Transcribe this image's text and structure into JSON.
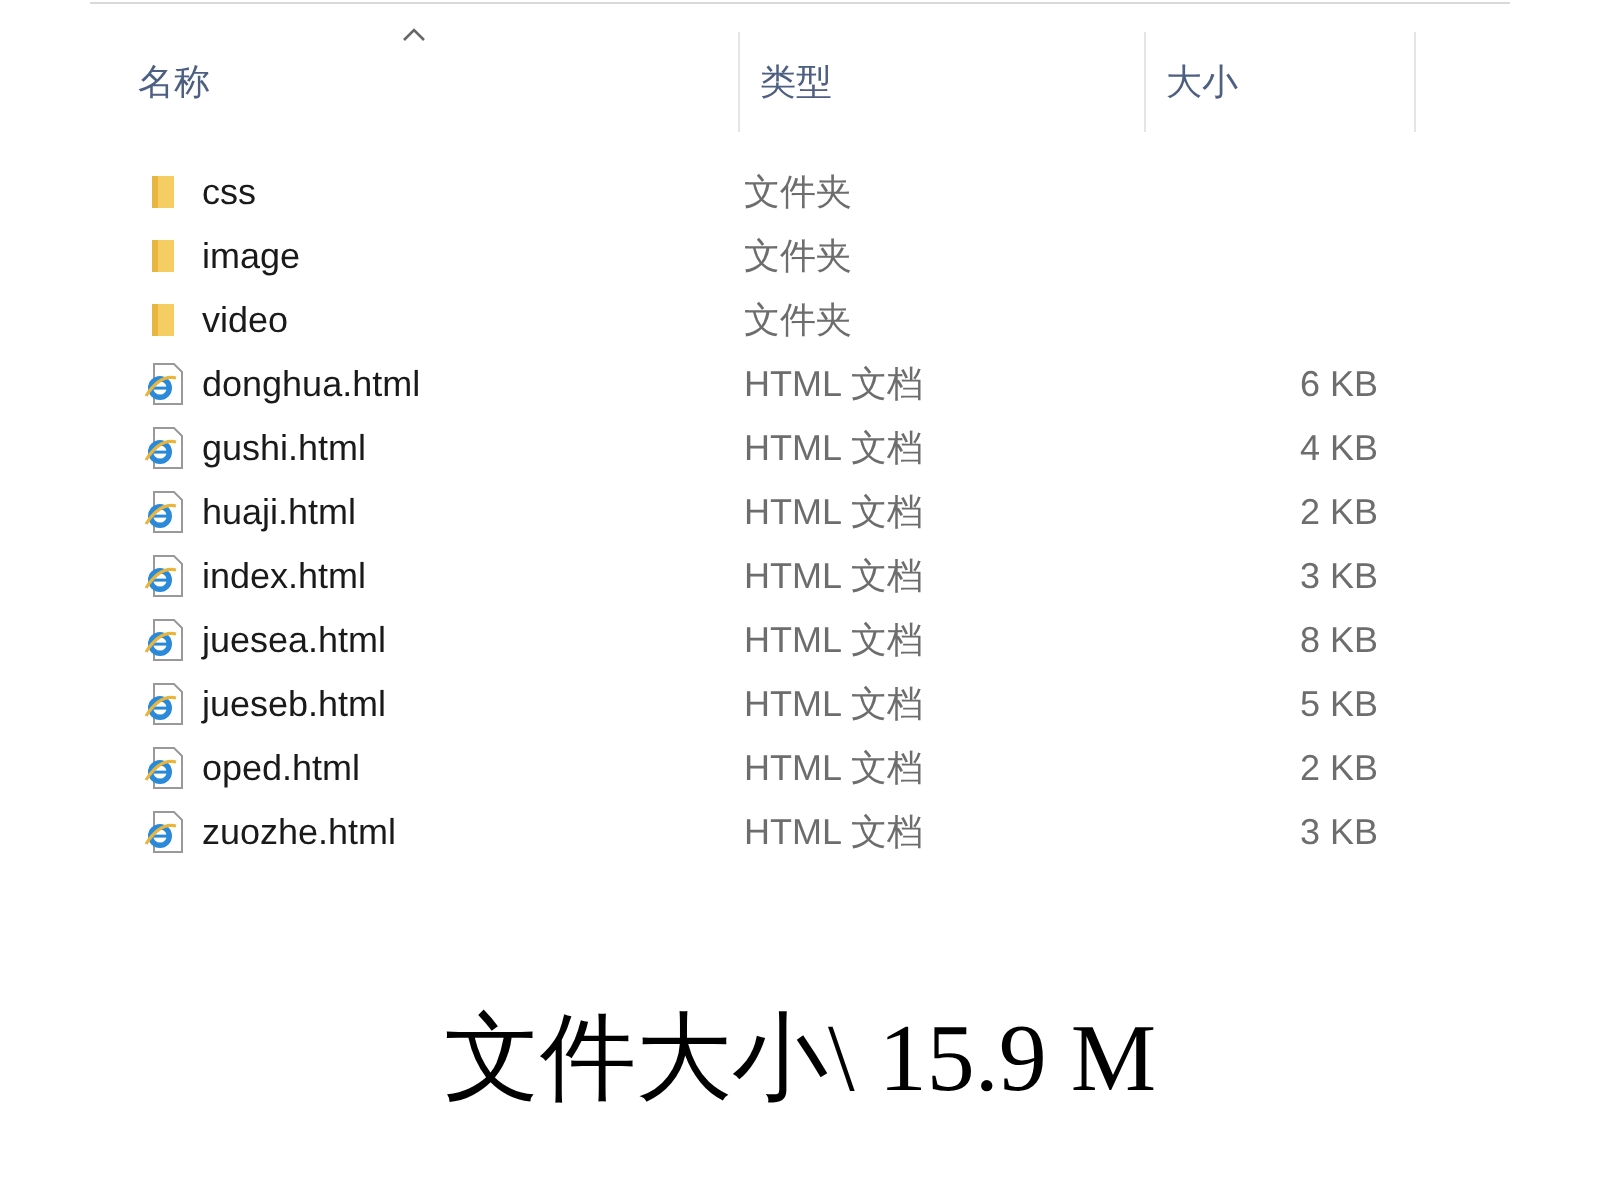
{
  "columns": [
    {
      "label": "名称",
      "sorted": true
    },
    {
      "label": "类型",
      "sorted": false
    },
    {
      "label": "大小",
      "sorted": false
    }
  ],
  "files": [
    {
      "kind": "folder",
      "name": "css",
      "type": "文件夹"
    },
    {
      "kind": "folder",
      "name": "image",
      "type": "文件夹"
    },
    {
      "kind": "folder",
      "name": "video",
      "type": "文件夹"
    },
    {
      "kind": "html",
      "name": "donghua.html",
      "type": "HTML 文档",
      "size": "6 KB"
    },
    {
      "kind": "html",
      "name": "gushi.html",
      "type": "HTML 文档",
      "size": "4 KB"
    },
    {
      "kind": "html",
      "name": "huaji.html",
      "type": "HTML 文档",
      "size": "2 KB"
    },
    {
      "kind": "html",
      "name": "index.html",
      "type": "HTML 文档",
      "size": "3 KB"
    },
    {
      "kind": "html",
      "name": "juesea.html",
      "type": "HTML 文档",
      "size": "8 KB"
    },
    {
      "kind": "html",
      "name": "jueseb.html",
      "type": "HTML 文档",
      "size": "5 KB"
    },
    {
      "kind": "html",
      "name": "oped.html",
      "type": "HTML 文档",
      "size": "2 KB"
    },
    {
      "kind": "html",
      "name": "zuozhe.html",
      "type": "HTML 文档",
      "size": "3 KB"
    }
  ],
  "caption": "文件大小\\ 15.9 M"
}
